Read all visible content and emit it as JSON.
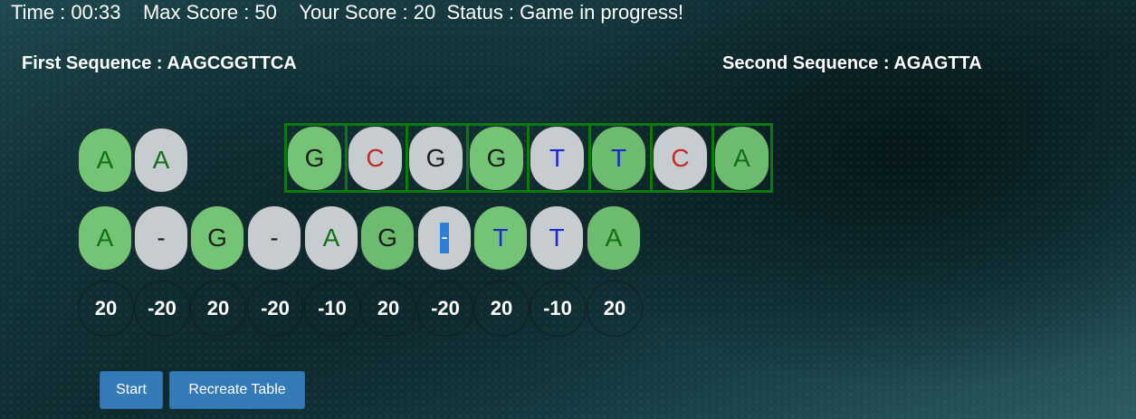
{
  "status": {
    "time_label": "Time : ",
    "time_value": "00:33",
    "max_label": "Max Score : ",
    "max_value": "50",
    "score_label": "Your Score : ",
    "score_value": "20",
    "status_label": "Status : ",
    "status_value": "Game in progress!"
  },
  "sequences": {
    "first_label": "First Sequence : AAGCGGTTCA",
    "second_label": "Second Sequence : AGAGTTA"
  },
  "row1": [
    {
      "letter": "A",
      "fill": "#74c476",
      "text_color": "#137015"
    },
    {
      "letter": "A",
      "fill": "#c6ccd0",
      "text_color": "#137015"
    },
    {
      "letter": "G",
      "fill": "#74c476",
      "text_color": "#1d1d1d"
    },
    {
      "letter": "C",
      "fill": "#c6ccd0",
      "text_color": "#c62828"
    },
    {
      "letter": "G",
      "fill": "#c6ccd0",
      "text_color": "#1d1d1d"
    },
    {
      "letter": "G",
      "fill": "#74c476",
      "text_color": "#1d1d1d"
    },
    {
      "letter": "T",
      "fill": "#c6ccd0",
      "text_color": "#1e2ad0"
    },
    {
      "letter": "T",
      "fill": "#6cbb6e",
      "text_color": "#1e2ad0"
    },
    {
      "letter": "C",
      "fill": "#c6ccd0",
      "text_color": "#c62828"
    },
    {
      "letter": "A",
      "fill": "#6cbb6e",
      "text_color": "#137015"
    }
  ],
  "row2": [
    {
      "letter": "A",
      "fill": "#74c476",
      "text_color": "#137015"
    },
    {
      "letter": "-",
      "fill": "#c6ccd0",
      "text_color": "#1d1d1d"
    },
    {
      "letter": "G",
      "fill": "#74c476",
      "text_color": "#1d1d1d"
    },
    {
      "letter": "-",
      "fill": "#c6ccd0",
      "text_color": "#1d1d1d"
    },
    {
      "letter": "A",
      "fill": "#c6ccd0",
      "text_color": "#137015"
    },
    {
      "letter": "G",
      "fill": "#6cbb6e",
      "text_color": "#1d1d1d"
    },
    {
      "letter": "-",
      "fill": "#c6ccd0",
      "text_color": "#ffffff",
      "selected": true
    },
    {
      "letter": "T",
      "fill": "#74c476",
      "text_color": "#1e2ad0"
    },
    {
      "letter": "T",
      "fill": "#c6ccd0",
      "text_color": "#1e2ad0"
    },
    {
      "letter": "A",
      "fill": "#6cbb6e",
      "text_color": "#137015"
    }
  ],
  "scores": [
    "20",
    "-20",
    "20",
    "-20",
    "-10",
    "20",
    "-20",
    "20",
    "-10",
    "20"
  ],
  "buttons": {
    "start": "Start",
    "recreate": "Recreate Table"
  },
  "colors": {
    "frame": "#0b7b0b",
    "button": "#337ab7",
    "selection": "#2d7fd6"
  }
}
